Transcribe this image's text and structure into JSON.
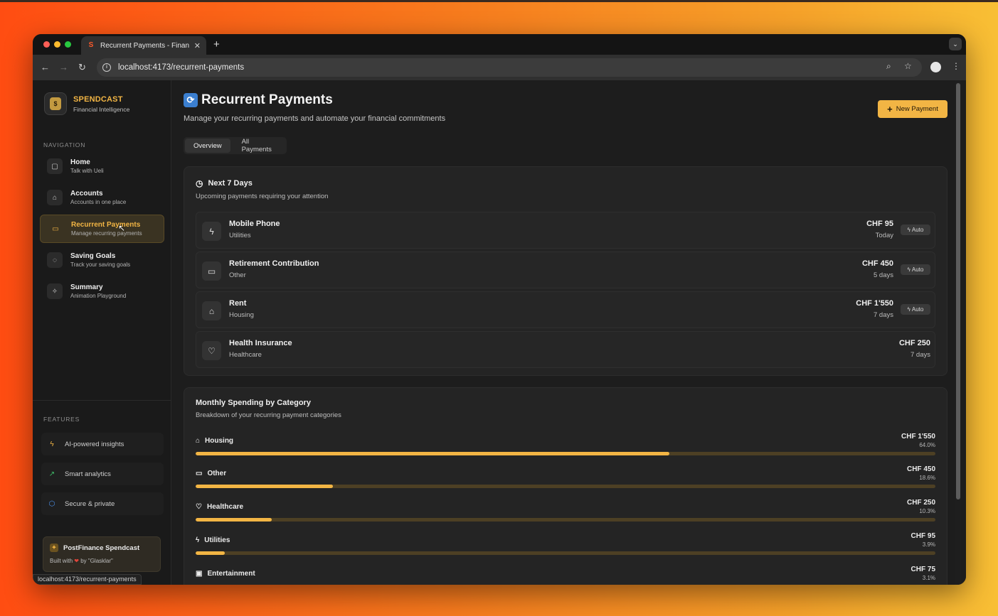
{
  "browser": {
    "tab_title": "Recurrent Payments - Financ",
    "tab_favicon": "S",
    "url": "localhost:4173/recurrent-payments",
    "status_url": "localhost:4173/recurrent-payments"
  },
  "brand": {
    "name": "SPENDCAST",
    "tagline": "Financial Intelligence",
    "logo_glyph": "$"
  },
  "sidebar": {
    "nav_label": "NAVIGATION",
    "items": [
      {
        "title": "Home",
        "subtitle": "Talk with Ueli",
        "icon": "chat-icon",
        "active": false
      },
      {
        "title": "Accounts",
        "subtitle": "Accounts in one place",
        "icon": "home-icon",
        "active": false
      },
      {
        "title": "Recurrent Payments",
        "subtitle": "Manage recurring payments",
        "icon": "card-icon",
        "active": true
      },
      {
        "title": "Saving Goals",
        "subtitle": "Track your saving goals",
        "icon": "piggy-bank-icon",
        "active": false
      },
      {
        "title": "Summary",
        "subtitle": "Animation Playground",
        "icon": "sparkles-icon",
        "active": false
      }
    ],
    "features_label": "FEATURES",
    "features": [
      {
        "label": "AI-powered insights",
        "icon": "bolt-icon",
        "color": "#f2b544"
      },
      {
        "label": "Smart analytics",
        "icon": "trending-up-icon",
        "color": "#3fbf6a"
      },
      {
        "label": "Secure & private",
        "icon": "shield-icon",
        "color": "#4b8fe8"
      }
    ],
    "promo": {
      "title": "PostFinance Spendcast",
      "built_prefix": "Built with",
      "built_suffix": "by \"Glasklar\""
    }
  },
  "header": {
    "title": "Recurrent Payments",
    "subtitle": "Manage your recurring payments and automate your financial commitments",
    "new_button": "New Payment"
  },
  "tabs": [
    {
      "label": "Overview",
      "active": true
    },
    {
      "label": "All Payments",
      "active": false
    }
  ],
  "upcoming": {
    "title": "Next 7 Days",
    "subtitle": "Upcoming payments requiring your attention",
    "auto_label": "Auto",
    "payments": [
      {
        "name": "Mobile Phone",
        "category": "Utilities",
        "amount": "CHF 95",
        "when": "Today",
        "auto": true,
        "icon": "bolt-icon"
      },
      {
        "name": "Retirement Contribution",
        "category": "Other",
        "amount": "CHF 450",
        "when": "5 days",
        "auto": true,
        "icon": "card-icon"
      },
      {
        "name": "Rent",
        "category": "Housing",
        "amount": "CHF 1'550",
        "when": "7 days",
        "auto": true,
        "icon": "home-icon"
      },
      {
        "name": "Health Insurance",
        "category": "Healthcare",
        "amount": "CHF 250",
        "when": "7 days",
        "auto": false,
        "icon": "stethoscope-icon"
      }
    ]
  },
  "spending": {
    "title": "Monthly Spending by Category",
    "subtitle": "Breakdown of your recurring payment categories",
    "categories": [
      {
        "name": "Housing",
        "amount": "CHF 1'550",
        "percent": "64.0%",
        "fraction": 0.64,
        "icon": "home-icon"
      },
      {
        "name": "Other",
        "amount": "CHF 450",
        "percent": "18.6%",
        "fraction": 0.186,
        "icon": "card-icon"
      },
      {
        "name": "Healthcare",
        "amount": "CHF 250",
        "percent": "10.3%",
        "fraction": 0.103,
        "icon": "stethoscope-icon"
      },
      {
        "name": "Utilities",
        "amount": "CHF 95",
        "percent": "3.9%",
        "fraction": 0.039,
        "icon": "bolt-icon"
      },
      {
        "name": "Entertainment",
        "amount": "CHF 75",
        "percent": "3.1%",
        "fraction": 0.031,
        "icon": "gamepad-icon"
      }
    ]
  },
  "colors": {
    "accent": "#f2b544",
    "bar_track": "#4d4024"
  }
}
